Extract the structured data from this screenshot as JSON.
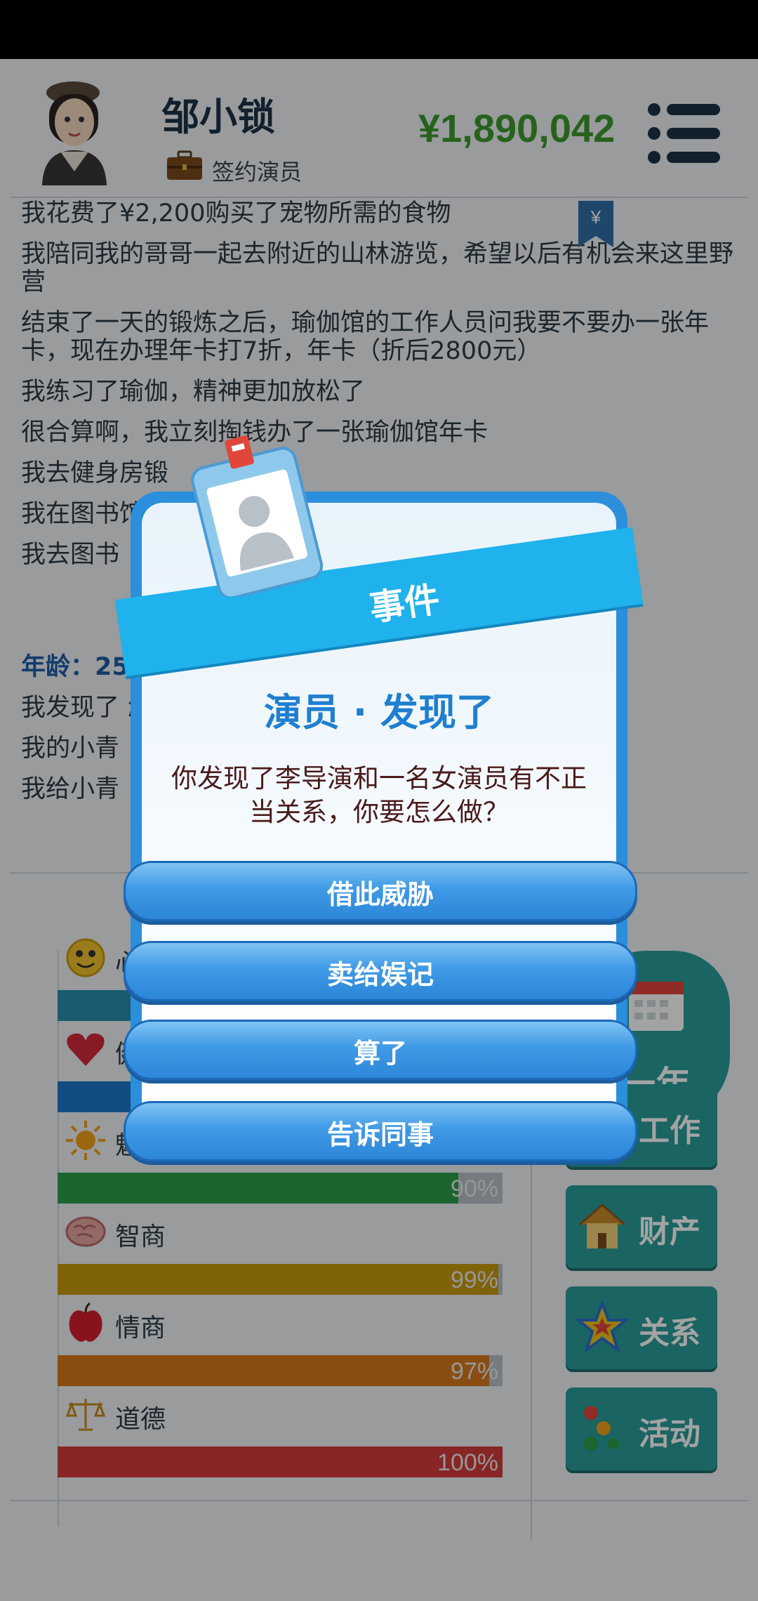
{
  "header": {
    "player_name": "邹小锁",
    "job_label": "签约演员",
    "money": "¥1,890,042"
  },
  "log": [
    "我花费了¥2,200购买了宠物所需的食物",
    "我陪同我的哥哥一起去附近的山林游览，希望以后有机会来这里野营",
    "结束了一天的锻炼之后，瑜伽馆的工作人员问我要不要办一张年卡，现在办理年卡打7折，年卡（折后2800元）",
    "我练习了瑜伽，精神更加放松了",
    "很合算啊，我立刻掏钱办了一张瑜伽馆年卡",
    "我去健身房锻",
    "我在图书馆                                                   叭接下来会涨，要",
    "我去图书"
  ],
  "log_age": "年龄：25",
  "log_after": [
    "我发现了                                                   怎么做？",
    "我的小青",
    "我给小青"
  ],
  "stats": [
    {
      "label": "心",
      "value": "",
      "color": "#2a8fb0",
      "pct": 94
    },
    {
      "label": "健",
      "value": "",
      "color": "#1f77c9",
      "pct": 94
    },
    {
      "label": "魅",
      "value": "90%",
      "color": "#2e9e4a",
      "pct": 90
    },
    {
      "label": "智商",
      "value": "99%",
      "color": "#c99a0c",
      "pct": 99
    },
    {
      "label": "情商",
      "value": "97%",
      "color": "#d8791a",
      "pct": 97
    },
    {
      "label": "道德",
      "value": "100%",
      "color": "#d53a3a",
      "pct": 100
    }
  ],
  "right_buttons": {
    "next_year": "一年",
    "work": "工作",
    "property": "财产",
    "relations": "关系",
    "activity": "活动"
  },
  "modal": {
    "ribbon_title": "事件",
    "event_title": "演员 · 发现了",
    "event_desc": "你发现了李导演和一名女演员有不正当关系，你要怎么做？",
    "choices": [
      "借此威胁",
      "卖给娱记",
      "算了",
      "告诉同事"
    ]
  },
  "colors": {
    "money": "#3e9a2e",
    "accent_blue": "#2b8fdc",
    "teal_button": "#2a9d99"
  }
}
